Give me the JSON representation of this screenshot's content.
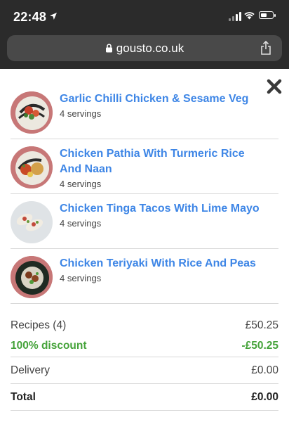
{
  "status_bar": {
    "time": "22:48"
  },
  "browser": {
    "url": "gousto.co.uk"
  },
  "recipes": [
    {
      "title": "Garlic Chilli Chicken & Sesame Veg",
      "servings": "4 servings"
    },
    {
      "title": "Chicken Pathia With Turmeric Rice And Naan",
      "servings": "4 servings"
    },
    {
      "title": "Chicken Tinga Tacos With Lime Mayo",
      "servings": "4 servings"
    },
    {
      "title": "Chicken Teriyaki With Rice And Peas",
      "servings": "4 servings"
    }
  ],
  "summary": {
    "recipes_label": "Recipes (4)",
    "recipes_value": "£50.25",
    "discount_label": "100% discount",
    "discount_value": "-£50.25",
    "delivery_label": "Delivery",
    "delivery_value": "£0.00",
    "total_label": "Total",
    "total_value": "£0.00"
  },
  "colors": {
    "link": "#3e86e6",
    "discount": "#45a33a",
    "chrome": "#2b2b2b"
  }
}
